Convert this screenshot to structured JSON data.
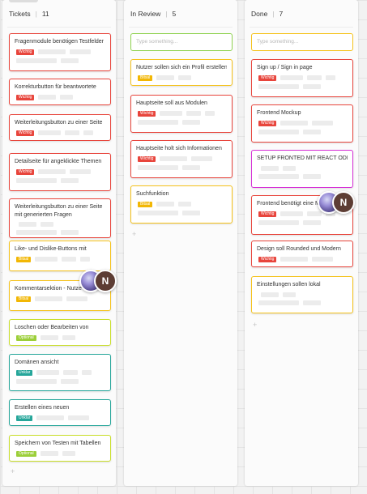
{
  "columns": [
    {
      "title": "Tickets",
      "count": "11",
      "cards": [
        {
          "title": "Fragenmodule benötigen Testfelder",
          "tag": "Wichtig",
          "tag_color": "#e8453c",
          "border": "#e8453c"
        },
        {
          "title": "Korrekturbutton für beantwortete",
          "tag": "Wichtig",
          "tag_color": "#e8453c",
          "border": "#e8453c"
        },
        {
          "title": "Weiterleitungsbutton zu einer Seite",
          "tag": "Wichtig",
          "tag_color": "#e8453c",
          "border": "#e8453c"
        },
        {
          "title": "Detailseite für angeklickte Themen",
          "tag": "Wichtig",
          "tag_color": "#e8453c",
          "border": "#e8453c"
        },
        {
          "title": "Weiterleitungsbutton zu einer Seite",
          "title2": "mit generierten Fragen",
          "tag": "",
          "tag_color": "#e8453c",
          "border": "#e8453c"
        },
        {
          "title": "Like- und Dislike-Buttons mit",
          "tag": "Bitsal",
          "tag_color": "#f2b705",
          "border": "#f5c21a"
        },
        {
          "title": "Kommentarsektion - Nutze",
          "tag": "Bitsal",
          "tag_color": "#f2b705",
          "border": "#f5c21a"
        },
        {
          "title": "Loschen oder Bearbeiten von",
          "tag": "Optional",
          "tag_color": "#9ccf3a",
          "border": "#c9de2a"
        },
        {
          "title": "Domänen ansicht",
          "tag": "Unklar",
          "tag_color": "#26a69a",
          "border": "#26a69a"
        },
        {
          "title": "Erstellen eines neuen",
          "tag": "Unklar",
          "tag_color": "#26a69a",
          "border": "#26a69a"
        },
        {
          "title": "Speichern von Testen mit Tabellen",
          "tag": "Optional",
          "tag_color": "#9ccf3a",
          "border": "#c9de2a"
        }
      ]
    },
    {
      "title": "In Review",
      "count": "5",
      "input_placeholder": "Type something...",
      "input_border": "#8fd14f",
      "cards": [
        {
          "title": "Nutzer sollen sich ein Profil erstellen",
          "tag": "Bitsal",
          "tag_color": "#f2b705",
          "border": "#f5c21a"
        },
        {
          "title": "Hauptseite soll aus Modulen",
          "tag": "Wichtig",
          "tag_color": "#e8453c",
          "border": "#e8453c"
        },
        {
          "title": "Hauptseite holt sich Informationen",
          "tag": "Wichtig",
          "tag_color": "#e8453c",
          "border": "#e8453c"
        },
        {
          "title": "Suchfunktion",
          "tag": "Bitsal",
          "tag_color": "#f2b705",
          "border": "#f5c21a"
        }
      ]
    },
    {
      "title": "Done",
      "count": "7",
      "input_placeholder": "Type something...",
      "input_border": "#f5c21a",
      "cards": [
        {
          "title": "Sign up / Sign in page",
          "tag": "Wichtig",
          "tag_color": "#e8453c",
          "border": "#e8453c"
        },
        {
          "title": "Frontend Mockup",
          "tag": "Wichtig",
          "tag_color": "#e8453c",
          "border": "#e8453c"
        },
        {
          "title": "SETUP FRONTED MIT REACT ODER",
          "tag": "",
          "tag_color": "",
          "border": "#d62fd6"
        },
        {
          "title": "Frontend benötigt eine M",
          "tag": "Wichtig",
          "tag_color": "#e8453c",
          "border": "#e8453c"
        },
        {
          "title": "Design soll Rounded und Modern",
          "tag": "Wichtig",
          "tag_color": "#e8453c",
          "border": "#e8453c"
        },
        {
          "title": "Einstellungen sollen lokal",
          "tag": "",
          "tag_color": "",
          "border": "#f5c21a"
        }
      ]
    }
  ],
  "add_symbol": "+",
  "avatar_initial": "N",
  "avatar_colors": {
    "initial_bg": "#5d3d34"
  }
}
